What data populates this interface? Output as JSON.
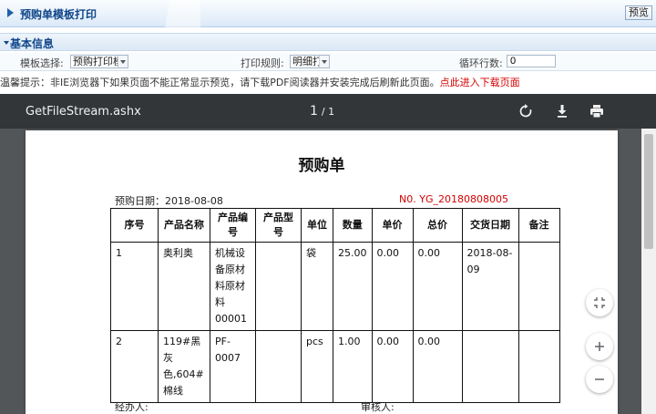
{
  "header": {
    "title": "预购单模板打印",
    "preview_label": "预览"
  },
  "basic_info": {
    "section_label": "基本信息",
    "template_label": "模板选择:",
    "template_value": "预购打印模",
    "print_rule_label": "打印规则:",
    "print_rule_value": "明细打",
    "loop_rows_label": "循环行数:",
    "loop_rows_value": "0"
  },
  "notice": {
    "text": "温馨提示：非IE浏览器下如果页面不能正常显示预览，请下载PDF阅读器并安装完成后刷新此页面。",
    "link": "点此进入下载页面"
  },
  "pdf_viewer": {
    "file_name": "GetFileStream.ashx",
    "current_page": "1",
    "total_pages": "/ 1",
    "icons": [
      "rotate-icon",
      "download-icon",
      "print-icon",
      "fit-page-icon",
      "zoom-in-icon",
      "zoom-out-icon"
    ]
  },
  "document": {
    "title": "预购单",
    "date_line": "预购日期：2018-08-08",
    "order_no": "N0. YG_20180808005",
    "columns": [
      "序号",
      "产品名称",
      "产品编号",
      "产品型号",
      "单位",
      "数量",
      "单价",
      "总价",
      "交货日期",
      "备注"
    ],
    "rows": [
      [
        "1",
        "奥利奥",
        "机械设备原材料原材料00001",
        "",
        "袋",
        "25.00",
        "0.00",
        "0.00",
        "2018-08-09",
        ""
      ],
      [
        "2",
        "119#黑灰色,604#棉线",
        "PF-0007",
        "",
        "pcs",
        "1.00",
        "0.00",
        "0.00",
        "",
        ""
      ]
    ],
    "handler_label": "经办人:",
    "reviewer_label": "审核人:"
  }
}
